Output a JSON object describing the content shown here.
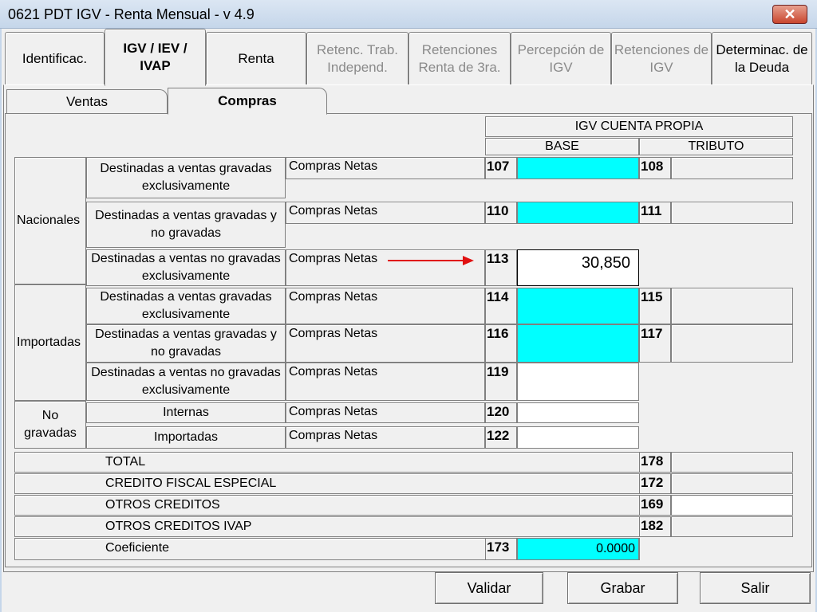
{
  "window": {
    "title": "0621 PDT IGV - Renta Mensual - v 4.9",
    "close_glyph": "✕"
  },
  "main_tabs": [
    {
      "label": "Identificac.",
      "state": "enabled"
    },
    {
      "label": "IGV / IEV / IVAP",
      "state": "active"
    },
    {
      "label": "Renta",
      "state": "enabled"
    },
    {
      "label": "Retenc. Trab. Independ.",
      "state": "disabled"
    },
    {
      "label": "Retenciones Renta de 3ra.",
      "state": "disabled"
    },
    {
      "label": "Percepción de IGV",
      "state": "disabled"
    },
    {
      "label": "Retenciones de IGV",
      "state": "disabled"
    },
    {
      "label": "Determinac. de la Deuda",
      "state": "enabled"
    }
  ],
  "sub_tabs": [
    {
      "label": "Ventas",
      "state": "enabled"
    },
    {
      "label": "Compras",
      "state": "active"
    }
  ],
  "headers": {
    "group": "IGV CUENTA PROPIA",
    "base": "BASE",
    "tributo": "TRIBUTO"
  },
  "groups": {
    "nacionales": "Nacionales",
    "importadas": "Importadas",
    "no_gravadas": "No gravadas"
  },
  "rows": [
    {
      "desc": "Destinadas a ventas gravadas exclusivamente",
      "type": "Compras Netas",
      "code_base": "107",
      "base_value": "",
      "code_trib": "108",
      "trib_value": ""
    },
    {
      "desc": "Destinadas a ventas gravadas y no gravadas",
      "type": "Compras Netas",
      "code_base": "110",
      "base_value": "",
      "code_trib": "111",
      "trib_value": ""
    },
    {
      "desc": "Destinadas a ventas no gravadas exclusivamente",
      "type": "Compras Netas",
      "code_base": "113",
      "base_value": "30,850"
    },
    {
      "desc": "Destinadas a ventas gravadas exclusivamente",
      "type": "Compras Netas",
      "code_base": "114",
      "base_value": "",
      "code_trib": "115",
      "trib_value": ""
    },
    {
      "desc": "Destinadas a ventas gravadas y no gravadas",
      "type": "Compras Netas",
      "code_base": "116",
      "base_value": "",
      "code_trib": "117",
      "trib_value": ""
    },
    {
      "desc": "Destinadas a ventas no gravadas  exclusivamente",
      "type": "Compras Netas",
      "code_base": "119",
      "base_value": ""
    },
    {
      "desc": "Internas",
      "type": "Compras Netas",
      "code_base": "120",
      "base_value": ""
    },
    {
      "desc": "Importadas",
      "type": "Compras Netas",
      "code_base": "122",
      "base_value": ""
    }
  ],
  "totals": [
    {
      "label": "TOTAL",
      "code": "178",
      "value": ""
    },
    {
      "label": "CREDITO FISCAL ESPECIAL",
      "code": "172",
      "value": ""
    },
    {
      "label": "OTROS CREDITOS",
      "code": "169",
      "value": ""
    },
    {
      "label": "OTROS CREDITOS IVAP",
      "code": "182",
      "value": ""
    }
  ],
  "coeficiente": {
    "label": "Coeficiente",
    "code": "173",
    "value": "0.0000"
  },
  "buttons": {
    "validar": "Validar",
    "grabar": "Grabar",
    "salir": "Salir"
  },
  "colors": {
    "field_cyan": "#00ffff",
    "arrow": "#e01010"
  }
}
